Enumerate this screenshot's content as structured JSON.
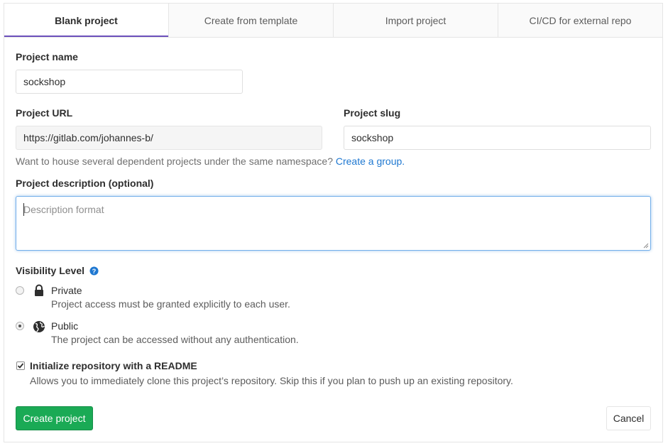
{
  "tabs": [
    {
      "label": "Blank project",
      "active": true
    },
    {
      "label": "Create from template",
      "active": false
    },
    {
      "label": "Import project",
      "active": false
    },
    {
      "label": "CI/CD for external repo",
      "active": false
    }
  ],
  "project_name": {
    "label": "Project name",
    "value": "sockshop"
  },
  "project_url": {
    "label": "Project URL",
    "value": "https://gitlab.com/johannes-b/"
  },
  "project_slug": {
    "label": "Project slug",
    "value": "sockshop"
  },
  "namespace_help": {
    "text": "Want to house several dependent projects under the same namespace?",
    "link": "Create a group."
  },
  "description": {
    "label": "Project description (optional)",
    "placeholder": "Description format"
  },
  "visibility": {
    "label": "Visibility Level",
    "help_icon": "question-circle-icon",
    "options": [
      {
        "title": "Private",
        "description": "Project access must be granted explicitly to each user.",
        "icon": "lock-icon",
        "checked": false
      },
      {
        "title": "Public",
        "description": "The project can be accessed without any authentication.",
        "icon": "globe-icon",
        "checked": true
      }
    ]
  },
  "readme": {
    "label": "Initialize repository with a README",
    "description": "Allows you to immediately clone this project’s repository. Skip this if you plan to push up an existing repository.",
    "checked": true
  },
  "buttons": {
    "create": "Create project",
    "cancel": "Cancel"
  },
  "colors": {
    "accent": "#6b4fbb",
    "link": "#1f78d1",
    "success": "#1aaa55",
    "focus": "#73afea"
  }
}
